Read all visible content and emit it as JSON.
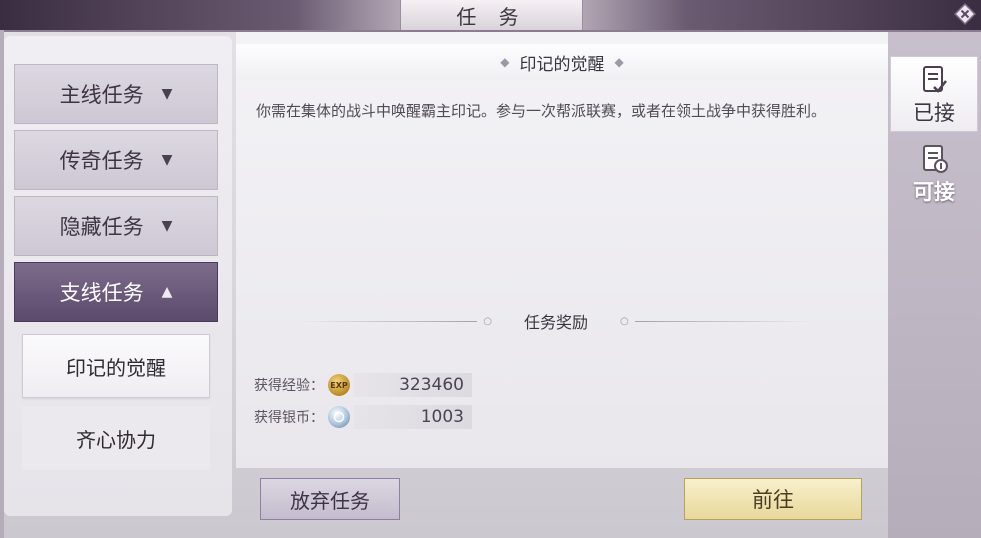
{
  "window": {
    "title": "任 务"
  },
  "categories": [
    {
      "label": "主线任务",
      "arrow": "▼",
      "expanded": false
    },
    {
      "label": "传奇任务",
      "arrow": "▼",
      "expanded": false
    },
    {
      "label": "隐藏任务",
      "arrow": "▼",
      "expanded": false
    },
    {
      "label": "支线任务",
      "arrow": "▲",
      "expanded": true
    }
  ],
  "sub_quests": [
    {
      "label": "印记的觉醒",
      "selected": true
    },
    {
      "label": "齐心协力",
      "selected": false
    }
  ],
  "quest": {
    "title": "印记的觉醒",
    "title_diamond": "◆",
    "description": "你需在集体的战斗中唤醒霸主印记。参与一次帮派联赛，或者在领土战争中获得胜利。"
  },
  "rewards": {
    "header": "任务奖励",
    "dot": "○",
    "items": [
      {
        "label": "获得经验：",
        "icon": "exp-icon",
        "icon_text": "EXP",
        "value": "323460"
      },
      {
        "label": "获得银币：",
        "icon": "silver-coin-icon",
        "icon_text": "",
        "value": "1003"
      }
    ]
  },
  "tabs": [
    {
      "label": "已接",
      "icon": "accepted-scroll-icon",
      "active": true
    },
    {
      "label": "可接",
      "icon": "available-scroll-icon",
      "active": false
    }
  ],
  "buttons": {
    "abandon": "放弃任务",
    "go": "前往"
  },
  "colors": {
    "active_category": "#5b4a6b",
    "go_button": "#e8d89a"
  }
}
